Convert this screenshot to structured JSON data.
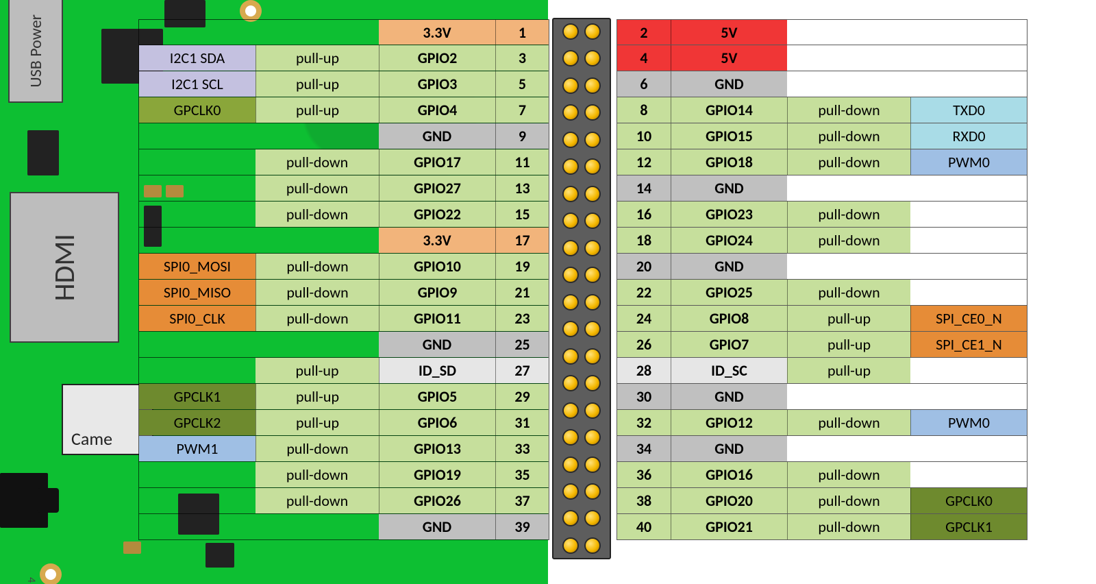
{
  "board_labels": {
    "usb_power": "USB Power",
    "hdmi": "HDMI",
    "camera": "Came",
    "corner_num": "4"
  },
  "colors": {
    "board_green": "#0DBF32",
    "v3v3": "#f2b47b",
    "v5": "#f03636",
    "gnd": "#c0c0c0",
    "gpio": "#c6df9c",
    "id": "#e6e6e6",
    "i2c": "#c4c1e0",
    "spi": "#e68c37",
    "uart": "#a9dce7",
    "pwm": "#9fbfe4",
    "clk": "#8aa63a"
  },
  "left_pins": [
    {
      "num": "1",
      "name": "3.3V",
      "name_t": "3v3"
    },
    {
      "num": "3",
      "name": "GPIO2",
      "name_t": "gpio",
      "pull": "pull-up",
      "alt": "I2C1 SDA",
      "alt_t": "i2c"
    },
    {
      "num": "5",
      "name": "GPIO3",
      "name_t": "gpio",
      "pull": "pull-up",
      "alt": "I2C1 SCL",
      "alt_t": "i2c"
    },
    {
      "num": "7",
      "name": "GPIO4",
      "name_t": "gpio",
      "pull": "pull-up",
      "alt": "GPCLK0",
      "alt_t": "clk"
    },
    {
      "num": "9",
      "name": "GND",
      "name_t": "gnd"
    },
    {
      "num": "11",
      "name": "GPIO17",
      "name_t": "gpio",
      "pull": "pull-down"
    },
    {
      "num": "13",
      "name": "GPIO27",
      "name_t": "gpio",
      "pull": "pull-down"
    },
    {
      "num": "15",
      "name": "GPIO22",
      "name_t": "gpio",
      "pull": "pull-down"
    },
    {
      "num": "17",
      "name": "3.3V",
      "name_t": "3v3"
    },
    {
      "num": "19",
      "name": "GPIO10",
      "name_t": "gpio",
      "pull": "pull-down",
      "alt": "SPI0_MOSI",
      "alt_t": "spi"
    },
    {
      "num": "21",
      "name": "GPIO9",
      "name_t": "gpio",
      "pull": "pull-down",
      "alt": "SPI0_MISO",
      "alt_t": "spi"
    },
    {
      "num": "23",
      "name": "GPIO11",
      "name_t": "gpio",
      "pull": "pull-down",
      "alt": "SPI0_CLK",
      "alt_t": "spi"
    },
    {
      "num": "25",
      "name": "GND",
      "name_t": "gnd"
    },
    {
      "num": "27",
      "name": "ID_SD",
      "name_t": "id",
      "pull": "pull-up"
    },
    {
      "num": "29",
      "name": "GPIO5",
      "name_t": "gpio",
      "pull": "pull-up",
      "alt": "GPCLK1",
      "alt_t": "clk-dark"
    },
    {
      "num": "31",
      "name": "GPIO6",
      "name_t": "gpio",
      "pull": "pull-up",
      "alt": "GPCLK2",
      "alt_t": "clk-dark"
    },
    {
      "num": "33",
      "name": "GPIO13",
      "name_t": "gpio",
      "pull": "pull-down",
      "alt": "PWM1",
      "alt_t": "pwm"
    },
    {
      "num": "35",
      "name": "GPIO19",
      "name_t": "gpio",
      "pull": "pull-down"
    },
    {
      "num": "37",
      "name": "GPIO26",
      "name_t": "gpio",
      "pull": "pull-down"
    },
    {
      "num": "39",
      "name": "GND",
      "name_t": "gnd"
    }
  ],
  "right_pins": [
    {
      "num": "2",
      "name": "5V",
      "name_t": "5v"
    },
    {
      "num": "4",
      "name": "5V",
      "name_t": "5v"
    },
    {
      "num": "6",
      "name": "GND",
      "name_t": "gnd"
    },
    {
      "num": "8",
      "name": "GPIO14",
      "name_t": "gpio",
      "pull": "pull-down",
      "alt": "TXD0",
      "alt_t": "uart"
    },
    {
      "num": "10",
      "name": "GPIO15",
      "name_t": "gpio",
      "pull": "pull-down",
      "alt": "RXD0",
      "alt_t": "uart"
    },
    {
      "num": "12",
      "name": "GPIO18",
      "name_t": "gpio",
      "pull": "pull-down",
      "alt": "PWM0",
      "alt_t": "pwm"
    },
    {
      "num": "14",
      "name": "GND",
      "name_t": "gnd"
    },
    {
      "num": "16",
      "name": "GPIO23",
      "name_t": "gpio",
      "pull": "pull-down"
    },
    {
      "num": "18",
      "name": "GPIO24",
      "name_t": "gpio",
      "pull": "pull-down"
    },
    {
      "num": "20",
      "name": "GND",
      "name_t": "gnd"
    },
    {
      "num": "22",
      "name": "GPIO25",
      "name_t": "gpio",
      "pull": "pull-down"
    },
    {
      "num": "24",
      "name": "GPIO8",
      "name_t": "gpio",
      "pull": "pull-up",
      "alt": "SPI_CE0_N",
      "alt_t": "spi"
    },
    {
      "num": "26",
      "name": "GPIO7",
      "name_t": "gpio",
      "pull": "pull-up",
      "alt": "SPI_CE1_N",
      "alt_t": "spi"
    },
    {
      "num": "28",
      "name": "ID_SC",
      "name_t": "id",
      "pull": "pull-up"
    },
    {
      "num": "30",
      "name": "GND",
      "name_t": "gnd"
    },
    {
      "num": "32",
      "name": "GPIO12",
      "name_t": "gpio",
      "pull": "pull-down",
      "alt": "PWM0",
      "alt_t": "pwm"
    },
    {
      "num": "34",
      "name": "GND",
      "name_t": "gnd"
    },
    {
      "num": "36",
      "name": "GPIO16",
      "name_t": "gpio",
      "pull": "pull-down"
    },
    {
      "num": "38",
      "name": "GPIO20",
      "name_t": "gpio",
      "pull": "pull-down",
      "alt": "GPCLK0",
      "alt_t": "clk-dark"
    },
    {
      "num": "40",
      "name": "GPIO21",
      "name_t": "gpio",
      "pull": "pull-down",
      "alt": "GPCLK1",
      "alt_t": "clk-dark"
    }
  ]
}
